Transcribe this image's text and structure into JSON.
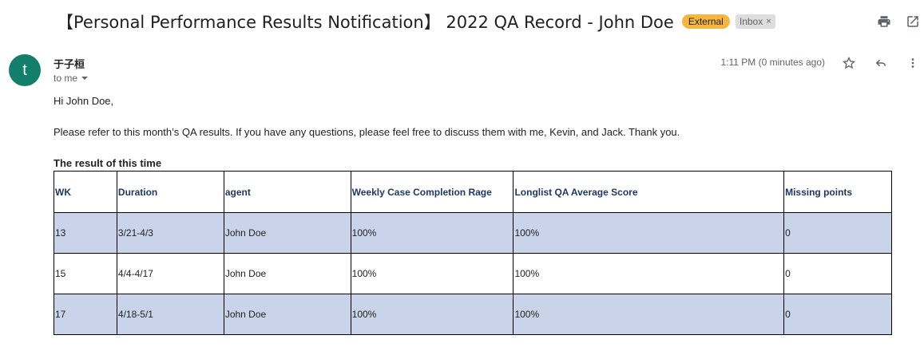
{
  "subject": {
    "title": "【Personal Performance Results Notification】 2022 QA Record - John Doe",
    "label_external": "External",
    "label_inbox": "Inbox",
    "label_inbox_close": "×"
  },
  "icons": {
    "print": "printer-icon",
    "popout": "open-in-new-window-icon",
    "star": "star-icon",
    "reply": "reply-icon",
    "more": "more-vertical-icon"
  },
  "message": {
    "avatar_letter": "t",
    "avatar_color": "#137f6b",
    "sender": "于子桓",
    "recipient": "to me",
    "timestamp": "1:11 PM (0 minutes ago)",
    "greeting": "Hi John Doe,",
    "paragraph": "Please refer to this month’s QA results. If you have any questions, please feel free to discuss them with me, Kevin, and Jack. Thank you.",
    "table_title": "The result of this time"
  },
  "table": {
    "headers": [
      "WK",
      "Duration",
      "agent",
      "Weekly Case Completion Rage",
      "Longlist QA Average Score",
      "Missing points"
    ],
    "rows": [
      [
        "13",
        "3/21-4/3",
        "John Doe",
        "100%",
        "100%",
        "0"
      ],
      [
        "15",
        "4/4-4/17",
        "John Doe",
        "100%",
        "100%",
        "0"
      ],
      [
        "17",
        "4/18-5/1",
        "John Doe",
        "100%",
        "100%",
        "0"
      ]
    ],
    "header_color": "#1f3864",
    "shaded_row_color": "#c9d4ea"
  }
}
